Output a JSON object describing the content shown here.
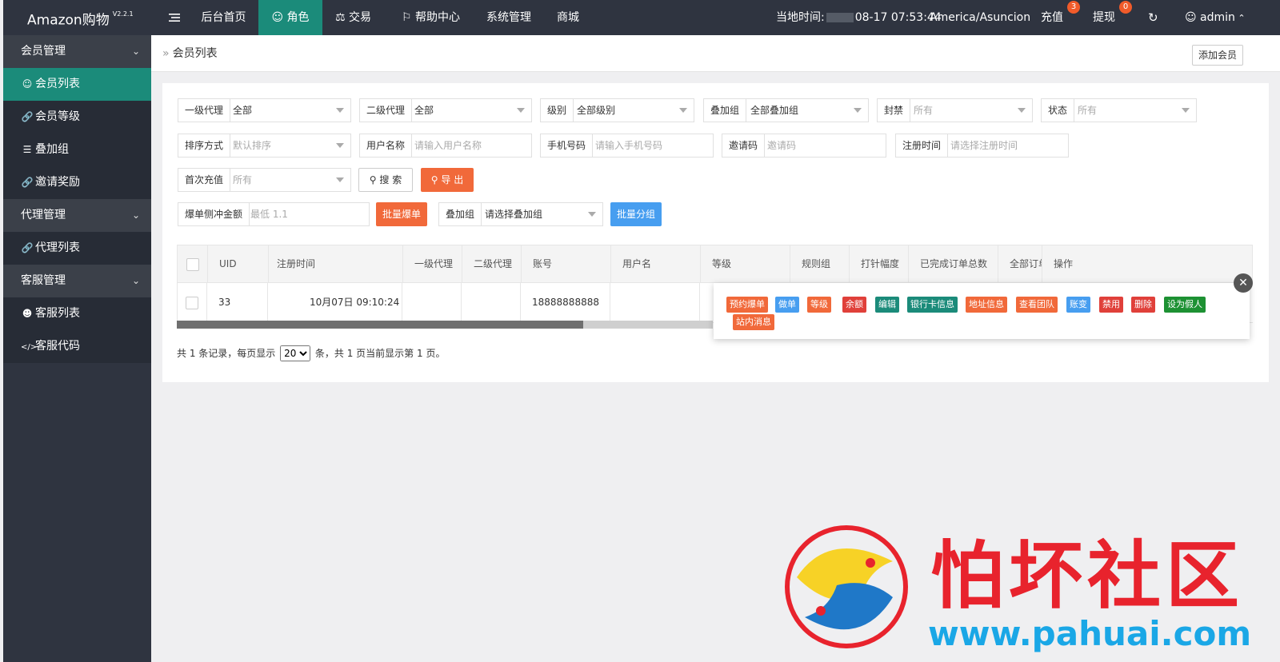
{
  "app": {
    "name": "Amazon购物",
    "version": "V2.2.1"
  },
  "topnav": {
    "menu_icon": "hamburger-icon",
    "items": [
      {
        "label": "后台首页"
      },
      {
        "label": "角色",
        "icon": "user-icon",
        "active": true
      },
      {
        "label": "交易",
        "icon": "scale-icon"
      },
      {
        "label": "帮助中心",
        "icon": "flag-icon"
      },
      {
        "label": "系统管理"
      },
      {
        "label": "商城"
      }
    ],
    "time_label": "当地时间:",
    "time_value": "08-17 07:53:44",
    "timezone": "America/Asuncion",
    "recharge": {
      "label": "充值",
      "badge": "3"
    },
    "withdraw": {
      "label": "提现",
      "badge": "0"
    },
    "refresh_icon": "refresh-icon",
    "user": {
      "name": "admin",
      "icon": "user-icon",
      "caret": "chevron-up-icon"
    }
  },
  "sidebar": {
    "groups": [
      {
        "label": "会员管理",
        "items": [
          {
            "label": "会员列表",
            "icon": "user-icon",
            "active": true
          },
          {
            "label": "会员等级",
            "icon": "link-icon"
          },
          {
            "label": "叠加组",
            "icon": "list-icon"
          },
          {
            "label": "邀请奖励",
            "icon": "link-icon"
          }
        ]
      },
      {
        "label": "代理管理",
        "items": [
          {
            "label": "代理列表",
            "icon": "link-icon"
          }
        ]
      },
      {
        "label": "客服管理",
        "items": [
          {
            "label": "客服列表",
            "icon": "users-icon"
          },
          {
            "label": "客服代码",
            "icon": "code-icon"
          }
        ]
      }
    ]
  },
  "breadcrumb": {
    "current": "会员列表",
    "add_button": "添加会员"
  },
  "filters": {
    "row1": [
      {
        "label": "一级代理",
        "value": "全部"
      },
      {
        "label": "二级代理",
        "value": "全部"
      },
      {
        "label": "级别",
        "value": "全部级别"
      },
      {
        "label": "叠加组",
        "value": "全部叠加组"
      },
      {
        "label": "封禁",
        "placeholder": "所有"
      },
      {
        "label": "状态",
        "placeholder": "所有"
      }
    ],
    "row2": [
      {
        "label": "排序方式",
        "placeholder": "默认排序"
      },
      {
        "label": "用户名称",
        "placeholder": "请输入用户名称"
      },
      {
        "label": "手机号码",
        "placeholder": "请输入手机号码"
      },
      {
        "label": "邀请码",
        "placeholder": "邀请码"
      },
      {
        "label": "注册时间",
        "placeholder": "请选择注册时间"
      }
    ],
    "row3": {
      "label": "首次充值",
      "placeholder": "所有",
      "search": "搜 索",
      "export": "导 出"
    },
    "row4": {
      "amount_label": "爆单侧冲金额",
      "amount_placeholder": "最低 1.1",
      "batch_boom": "批量爆单",
      "group_label": "叠加组",
      "group_value": "请选择叠加组",
      "batch_group": "批量分组"
    }
  },
  "table": {
    "columns": [
      "UID",
      "注册时间",
      "一级代理",
      "二级代理",
      "账号",
      "用户名",
      "等级",
      "规则组",
      "打针幅度",
      "已完成订单总数",
      "全部订单",
      "操作"
    ],
    "rows": [
      {
        "uid": "33",
        "reg_time": "10月07日 09:10:24",
        "agent1": "",
        "agent2": "",
        "account": "18888888888",
        "username": ""
      }
    ]
  },
  "pager": {
    "prefix": "共 1 条记录，每页显示",
    "size": "20",
    "suffix": "条，共 1 页当前显示第 1 页。"
  },
  "actions": [
    {
      "label": "预约爆单",
      "color": "#f1693a"
    },
    {
      "label": "做单",
      "color": "#479ef0"
    },
    {
      "label": "等级",
      "color": "#f1693a"
    },
    {
      "label": "余额",
      "color": "#e0403a"
    },
    {
      "label": "编辑",
      "color": "#1b8b7a"
    },
    {
      "label": "银行卡信息",
      "color": "#1b8b7a"
    },
    {
      "label": "地址信息",
      "color": "#f1693a"
    },
    {
      "label": "查看团队",
      "color": "#f1693a"
    },
    {
      "label": "账变",
      "color": "#479ef0"
    },
    {
      "label": "禁用",
      "color": "#e0403a"
    },
    {
      "label": "删除",
      "color": "#e0403a"
    },
    {
      "label": "设为假人",
      "color": "#1d9133"
    },
    {
      "label": "站内消息",
      "color": "#f1693a"
    }
  ],
  "watermark": {
    "text": "怕坏社区",
    "url": "www.pahuai.com"
  }
}
